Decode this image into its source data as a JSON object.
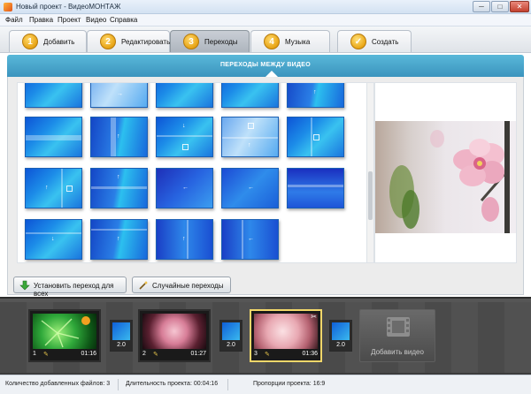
{
  "window": {
    "title": "Новый проект - ВидеоМОНТАЖ",
    "min": "─",
    "max": "□",
    "close": "✕"
  },
  "menu": [
    "Файл",
    "Правка",
    "Проект",
    "Видео",
    "Справка"
  ],
  "tabs": [
    {
      "num": "1",
      "label": "Добавить"
    },
    {
      "num": "2",
      "label": "Редактировать"
    },
    {
      "num": "3",
      "label": "Переходы"
    },
    {
      "num": "4",
      "label": "Музыка"
    },
    {
      "num": "✓",
      "label": "Создать"
    }
  ],
  "active_tab": "Переходы",
  "section_title": "ПЕРЕХОДЫ МЕЖДУ ВИДЕО",
  "buttons": {
    "apply_all": "Установить переход для всех",
    "random": "Случайные переходы"
  },
  "clips": [
    {
      "index": "1",
      "duration": "01:16"
    },
    {
      "index": "2",
      "duration": "01:27"
    },
    {
      "index": "3",
      "duration": "01:36"
    }
  ],
  "transitions": [
    "2.0",
    "2.0",
    "2.0"
  ],
  "add_video": "Добавить видео",
  "status": {
    "files": "Количество добавленных файлов: 3",
    "duration": "Длительность проекта: 00:04:16",
    "ratio": "Пропорции проекта: 16:9"
  },
  "colors": {
    "accent": "#3b94be",
    "selection": "#f2d76a",
    "thumb_blue": "#1c8ce8"
  }
}
